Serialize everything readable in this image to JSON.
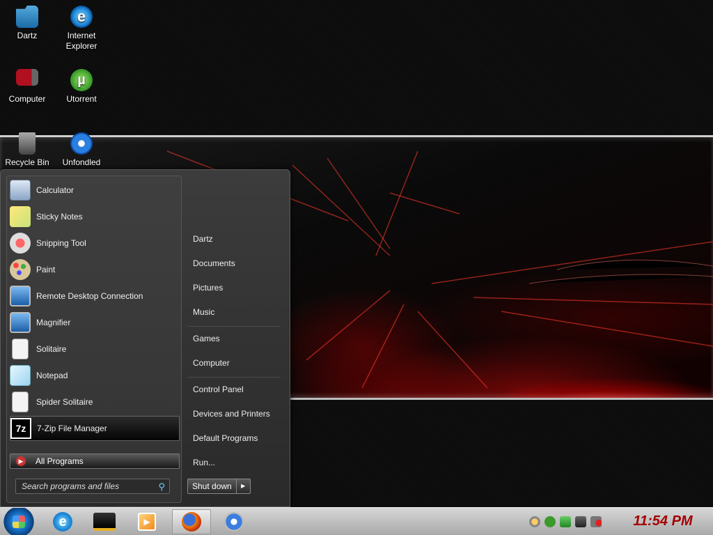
{
  "desktop": {
    "icons": [
      {
        "label": "Dartz",
        "icon": "dartz-folder-icon"
      },
      {
        "label": "Internet\nExplorer",
        "icon": "internet-explorer-icon"
      },
      {
        "label": "Computer",
        "icon": "computer-icon"
      },
      {
        "label": "Utorrent",
        "icon": "utorrent-icon"
      },
      {
        "label": "Recycle Bin",
        "icon": "recycle-bin-icon"
      },
      {
        "label": "Unfondled",
        "icon": "unfondled-chrome-icon"
      }
    ]
  },
  "start_menu": {
    "programs": [
      {
        "label": "Calculator",
        "icon": "calculator-icon"
      },
      {
        "label": "Sticky Notes",
        "icon": "sticky-notes-icon"
      },
      {
        "label": "Snipping Tool",
        "icon": "snipping-tool-icon"
      },
      {
        "label": "Paint",
        "icon": "paint-icon"
      },
      {
        "label": "Remote Desktop Connection",
        "icon": "remote-desktop-icon"
      },
      {
        "label": "Magnifier",
        "icon": "magnifier-icon"
      },
      {
        "label": "Solitaire",
        "icon": "solitaire-icon"
      },
      {
        "label": "Notepad",
        "icon": "notepad-icon"
      },
      {
        "label": "Spider Solitaire",
        "icon": "spider-solitaire-icon"
      },
      {
        "label": "7-Zip File Manager",
        "icon": "7zip-icon"
      }
    ],
    "all_programs": "All Programs",
    "search_placeholder": "Search programs and files",
    "places": [
      "Dartz",
      "Documents",
      "Pictures",
      "Music",
      "Games",
      "Computer",
      "Control Panel",
      "Devices and Printers",
      "Default Programs",
      "Run..."
    ],
    "shutdown_label": "Shut down",
    "shutdown_arrow": "▶"
  },
  "taskbar": {
    "pinned": [
      "internet-explorer-icon",
      "winamp-icon",
      "media-player-icon",
      "firefox-icon",
      "chrome-icon"
    ],
    "tray": [
      "network-icon",
      "utorrent-icon",
      "security-icon",
      "connection-icon",
      "volume-muted-icon"
    ],
    "clock": "11:54 PM"
  },
  "colors": {
    "accent": "#a40000",
    "orb": "#1570c4"
  }
}
